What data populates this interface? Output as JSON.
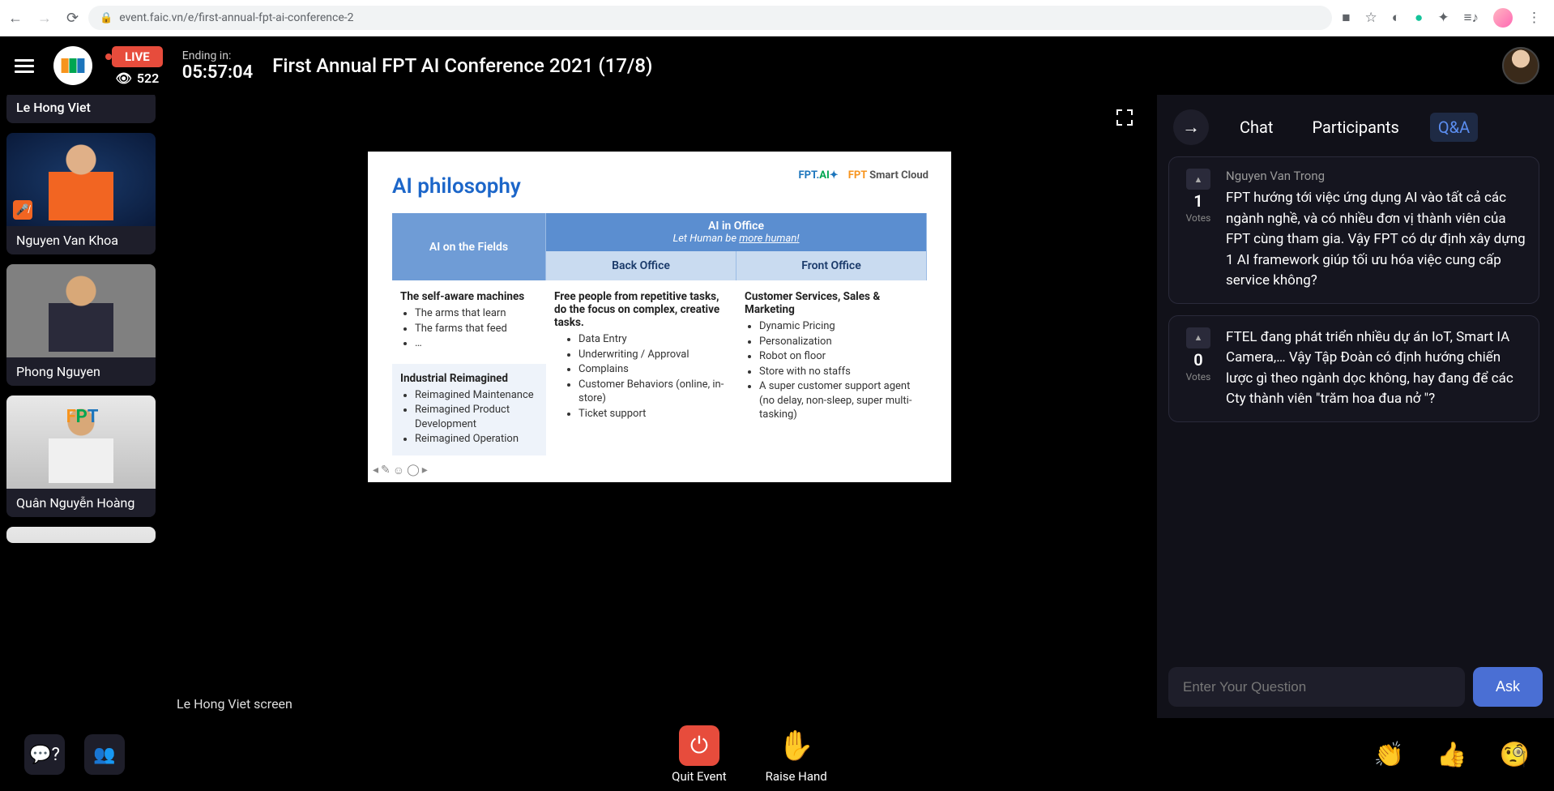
{
  "chrome": {
    "url": "event.faic.vn/e/first-annual-fpt-ai-conference-2"
  },
  "header": {
    "live": "LIVE",
    "viewer_count": "522",
    "ending_label": "Ending in:",
    "ending_time": "05:57:04",
    "event_title": "First Annual FPT AI Conference 2021 (17/8)"
  },
  "sidebar": {
    "top_name": "Le Hong Viet",
    "participants": [
      {
        "name": "Nguyen Van Khoa",
        "muted": true
      },
      {
        "name": "Phong Nguyen",
        "muted": false
      },
      {
        "name": "Quân Nguyễn Hoàng",
        "muted": false
      }
    ]
  },
  "slide": {
    "title": "AI philosophy",
    "logo_ai": "FPT.AI",
    "logo_cloud_fpt": "FPT",
    "logo_cloud_text": "Smart Cloud",
    "col_left_header": "AI on the Fields",
    "col_right_top_header": "AI in Office",
    "col_right_top_sub_prefix": "Let Human be ",
    "col_right_top_sub_em": "more human!",
    "col_back": "Back Office",
    "col_front": "Front Office",
    "left_block1_title": "The self-aware machines",
    "left_block1_items": [
      "The arms that learn",
      "The farms that feed",
      "…"
    ],
    "left_block2_title": "Industrial Reimagined",
    "left_block2_items": [
      "Reimagined Maintenance",
      "Reimagined Product Development",
      "Reimagined Operation"
    ],
    "back_title": "Free people from repetitive tasks, do the focus on complex, creative tasks.",
    "back_items": [
      "Data Entry",
      "Underwriting / Approval",
      "Complains",
      "Customer Behaviors (online, in-store)",
      "Ticket support"
    ],
    "front_title": "Customer Services, Sales & Marketing",
    "front_items": [
      "Dynamic Pricing",
      "Personalization",
      "Robot on floor",
      "Store with no staffs",
      "A super customer support agent (no delay, non-sleep, super multi-tasking)"
    ],
    "screen_label": "Le Hong Viet screen"
  },
  "panel": {
    "tabs": {
      "chat": "Chat",
      "participants": "Participants",
      "qa": "Q&A"
    },
    "questions": [
      {
        "votes": "1",
        "votes_label": "Votes",
        "author": "Nguyen Van Trong",
        "text": "FPT hướng tới việc ứng dụng AI vào tất cả các ngành nghề, và có nhiều đơn vị thành viên của FPT cùng tham gia. Vậy FPT có dự định xây dựng 1 AI framework giúp tối ưu hóa việc cung cấp service không?"
      },
      {
        "votes": "0",
        "votes_label": "Votes",
        "author": "",
        "text": "FTEL đang phát triển nhiều dự án IoT, Smart IA Camera,… Vậy Tập Đoàn có định hướng chiến lược gì theo ngành dọc không, hay đang để các Cty thành viên \"trăm hoa đua nở \"?"
      }
    ],
    "input_placeholder": "Enter Your Question",
    "ask": "Ask"
  },
  "bottom": {
    "quit": "Quit Event",
    "raise": "Raise Hand"
  }
}
